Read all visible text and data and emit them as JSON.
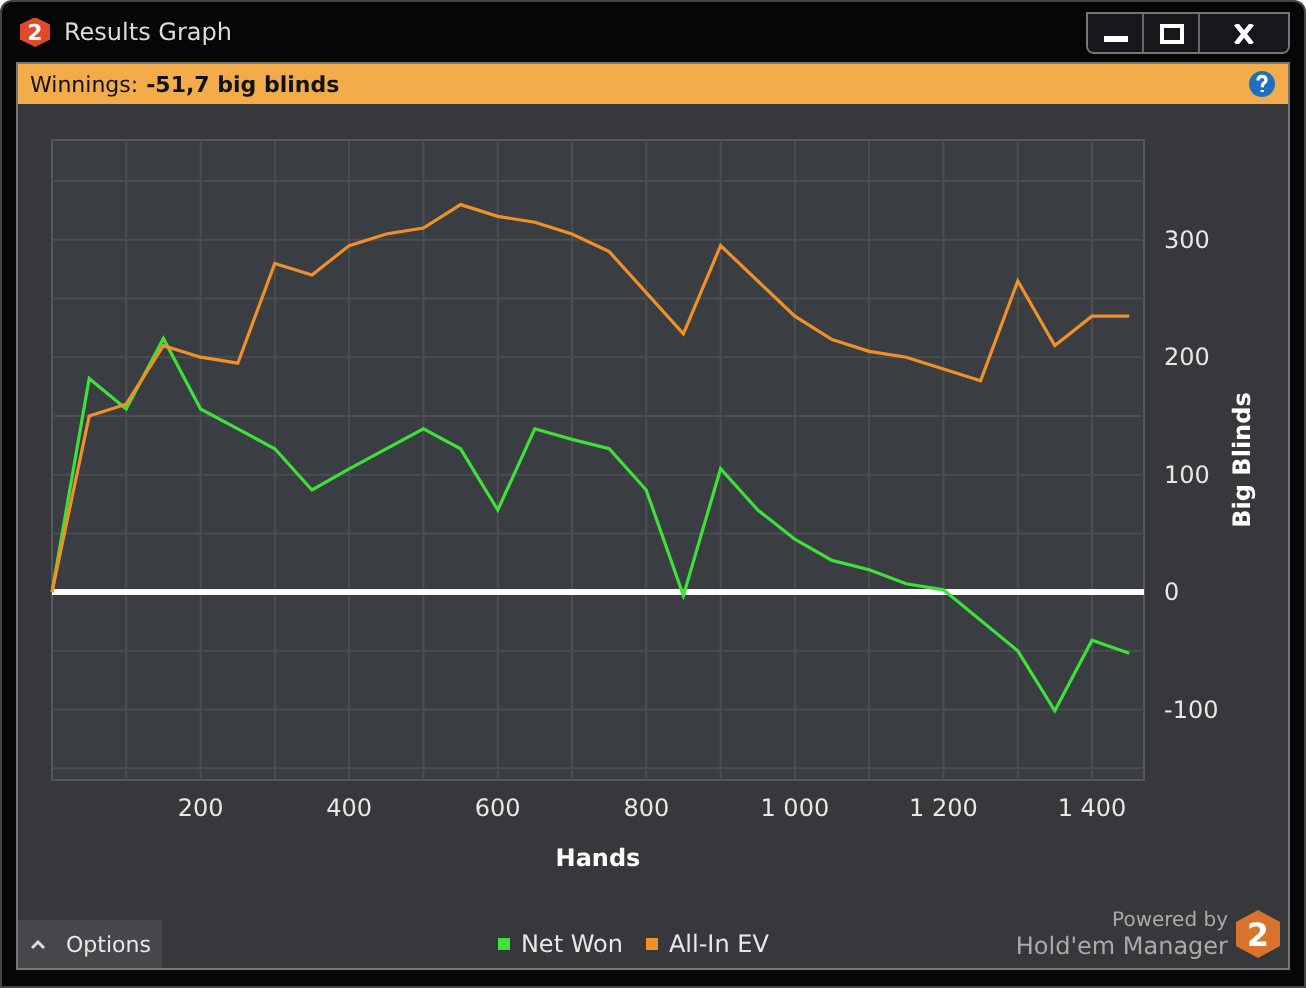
{
  "window": {
    "title": "Results Graph",
    "badge": "2"
  },
  "summary": {
    "label": "Winnings:",
    "value": "-51,7 big blinds"
  },
  "chart_data": {
    "type": "line",
    "xlabel": "Hands",
    "ylabel": "Big Blinds",
    "xlim": [
      0,
      1470
    ],
    "ylim": [
      -160,
      385
    ],
    "x": [
      0,
      50,
      100,
      150,
      200,
      250,
      300,
      350,
      400,
      450,
      500,
      550,
      600,
      650,
      700,
      750,
      800,
      850,
      900,
      950,
      1000,
      1050,
      1100,
      1150,
      1200,
      1250,
      1300,
      1350,
      1400,
      1450
    ],
    "series": [
      {
        "name": "Net Won",
        "color": "#3ee03a",
        "values": [
          0,
          182,
          156,
          216,
          156,
          139,
          122,
          87,
          105,
          122,
          139,
          122,
          70,
          139,
          130,
          122,
          87,
          -3,
          105,
          70,
          45,
          27,
          19,
          7,
          2,
          -24,
          -50,
          -101,
          -41,
          -52
        ]
      },
      {
        "name": "All-In EV",
        "color": "#f0902a",
        "values": [
          0,
          150,
          160,
          210,
          200,
          195,
          280,
          270,
          295,
          305,
          310,
          330,
          320,
          315,
          305,
          290,
          255,
          220,
          295,
          265,
          235,
          215,
          205,
          200,
          190,
          180,
          265,
          210,
          235,
          235
        ]
      }
    ],
    "xticks": [
      200,
      400,
      600,
      800,
      {
        "value": 1000,
        "label": "1 000"
      },
      {
        "value": 1200,
        "label": "1 200"
      },
      {
        "value": 1400,
        "label": "1 400"
      }
    ],
    "yticks": [
      -100,
      0,
      100,
      200,
      300
    ],
    "grid": true
  },
  "options_button": {
    "label": "Options"
  },
  "branding": {
    "powered_by": "Powered by",
    "product": "Hold'em Manager",
    "logo": "2"
  }
}
